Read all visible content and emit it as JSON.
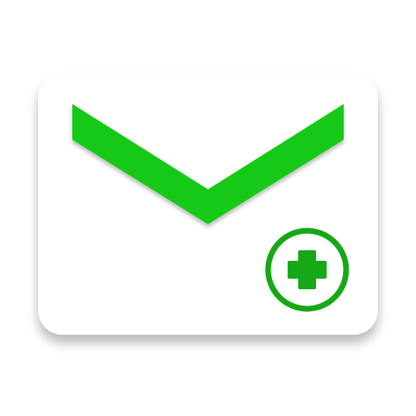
{
  "icon": {
    "name": "mail-add-icon",
    "envelope_icon": "envelope-icon",
    "chevron_icon": "envelope-flap-chevron-icon",
    "badge_icon": "plus-circle-icon",
    "colors": {
      "background": "#ffffff",
      "card": "#ffffff",
      "accent": "#15c915",
      "badge_ring": "#16a816",
      "plus": "#16a816",
      "shadow": "#000000"
    }
  }
}
